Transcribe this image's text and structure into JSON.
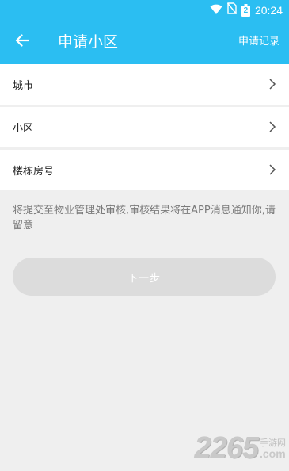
{
  "status_bar": {
    "time": "20:24",
    "battery_level": "2",
    "icons": [
      "wifi-icon",
      "no-sim-icon",
      "battery-icon"
    ]
  },
  "header": {
    "title": "申请小区",
    "record_link": "申请记录",
    "background_color": "#2bbef2"
  },
  "form": {
    "rows": [
      {
        "label": "城市"
      },
      {
        "label": "小区"
      },
      {
        "label": "楼栋房号"
      }
    ]
  },
  "notice": "将提交至物业管理处审核,审核结果将在APP消息通知你,请留意",
  "next_button": {
    "label": "下一步",
    "enabled": false
  },
  "watermark": {
    "number": "2265",
    "site_cn": "手游网",
    "site_domain": ".com"
  }
}
